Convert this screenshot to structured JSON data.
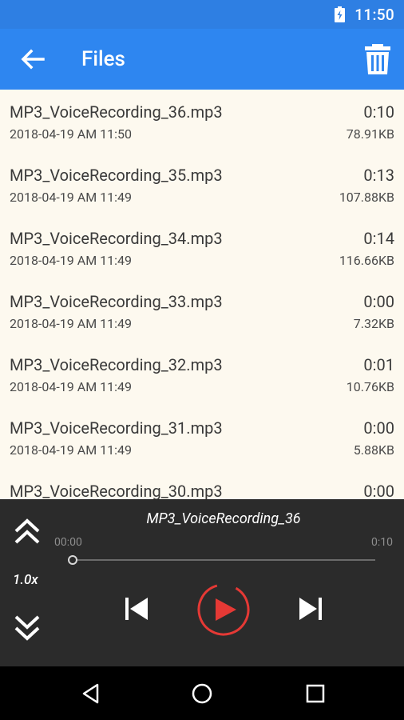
{
  "status_bar": {
    "time": "11:50",
    "battery_icon": "battery-charging-icon"
  },
  "app_bar": {
    "title": "Files",
    "back_icon": "arrow-back-icon",
    "delete_icon": "trash-icon",
    "color": "#2e86f0"
  },
  "files": [
    {
      "name": "MP3_VoiceRecording_36.mp3",
      "date": "2018-04-19 AM 11:50",
      "duration": "0:10",
      "size": "78.91KB"
    },
    {
      "name": "MP3_VoiceRecording_35.mp3",
      "date": "2018-04-19 AM 11:49",
      "duration": "0:13",
      "size": "107.88KB"
    },
    {
      "name": "MP3_VoiceRecording_34.mp3",
      "date": "2018-04-19 AM 11:49",
      "duration": "0:14",
      "size": "116.66KB"
    },
    {
      "name": "MP3_VoiceRecording_33.mp3",
      "date": "2018-04-19 AM 11:49",
      "duration": "0:00",
      "size": "7.32KB"
    },
    {
      "name": "MP3_VoiceRecording_32.mp3",
      "date": "2018-04-19 AM 11:49",
      "duration": "0:01",
      "size": "10.76KB"
    },
    {
      "name": "MP3_VoiceRecording_31.mp3",
      "date": "2018-04-19 AM 11:49",
      "duration": "0:00",
      "size": "5.88KB"
    },
    {
      "name": "MP3_VoiceRecording_30.mp3",
      "date": "",
      "duration": "0:00",
      "size": ""
    }
  ],
  "player": {
    "title": "MP3_VoiceRecording_36",
    "current_time": "00:00",
    "total_time": "0:10",
    "progress": 0,
    "speed": "1.0x",
    "accent_color": "#e53935",
    "icons": {
      "speed_up": "double-chevron-up-icon",
      "speed_down": "double-chevron-down-icon",
      "previous": "skip-previous-icon",
      "play": "play-icon",
      "next": "skip-next-icon"
    }
  },
  "nav_bar": {
    "back": "nav-back-icon",
    "home": "nav-home-icon",
    "recents": "nav-recents-icon"
  }
}
